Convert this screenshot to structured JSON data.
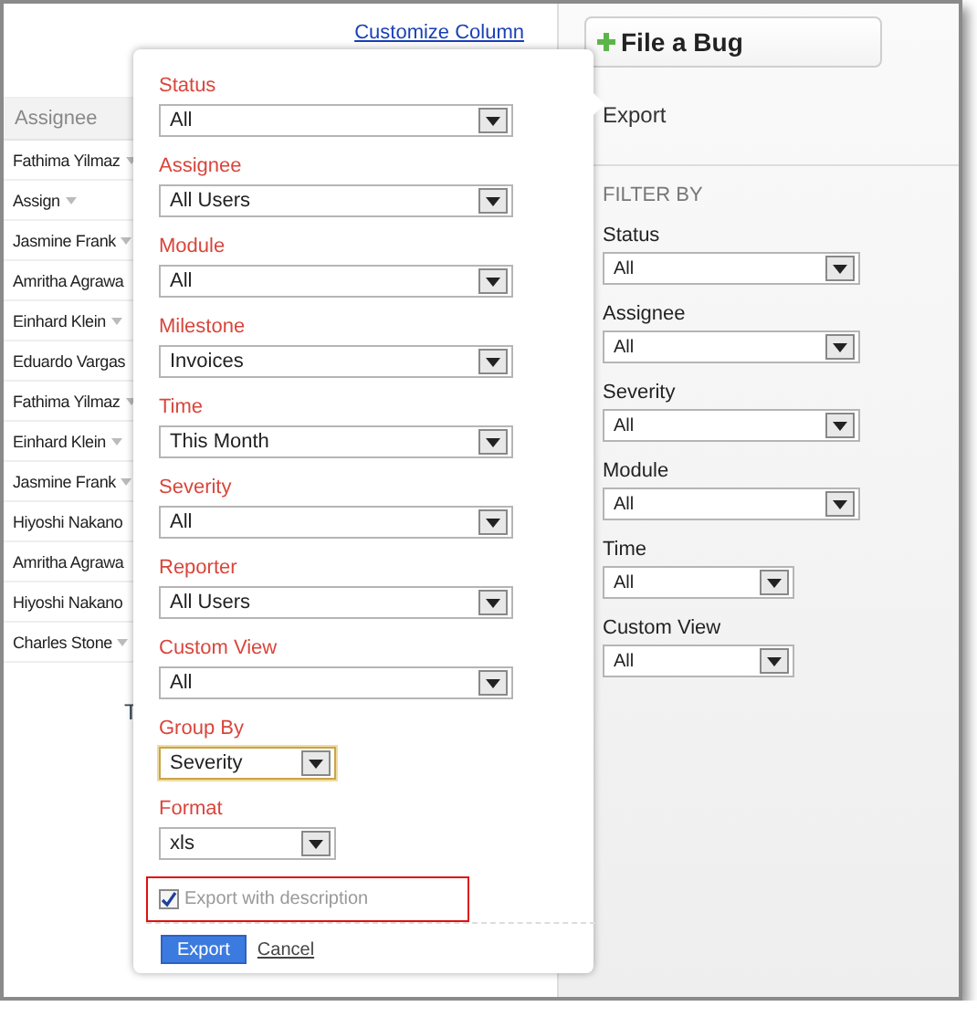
{
  "table": {
    "customize_link": "Customize Column",
    "header": "Assignee",
    "rows": [
      {
        "assignee": "Fathima Yilmaz",
        "caret": true
      },
      {
        "assignee": "Assign",
        "caret": true
      },
      {
        "assignee": "Jasmine Frank",
        "caret": true
      },
      {
        "assignee": "Amritha Agrawa",
        "caret": false
      },
      {
        "assignee": "Einhard Klein",
        "caret": true
      },
      {
        "assignee": "Eduardo Vargas",
        "caret": false
      },
      {
        "assignee": "Fathima Yilmaz",
        "caret": true
      },
      {
        "assignee": "Einhard Klein",
        "caret": true
      },
      {
        "assignee": "Jasmine Frank",
        "caret": true
      },
      {
        "assignee": "Hiyoshi Nakano",
        "caret": false
      },
      {
        "assignee": "Amritha Agrawa",
        "caret": false
      },
      {
        "assignee": "Hiyoshi Nakano",
        "caret": false
      },
      {
        "assignee": "Charles Stone",
        "caret": true
      }
    ],
    "footer_text": "T"
  },
  "sidebar": {
    "file_bug_button": "File a Bug",
    "export_link": "Export",
    "filter_heading": "FILTER BY",
    "filters": [
      {
        "label": "Status",
        "value": "All"
      },
      {
        "label": "Assignee",
        "value": "All"
      },
      {
        "label": "Severity",
        "value": "All"
      },
      {
        "label": "Module",
        "value": "All"
      },
      {
        "label": "Time",
        "value": "All"
      },
      {
        "label": "Custom View",
        "value": "All"
      }
    ]
  },
  "export_dialog": {
    "fields": [
      {
        "label": "Status",
        "value": "All",
        "focused": false
      },
      {
        "label": "Assignee",
        "value": "All Users",
        "focused": false
      },
      {
        "label": "Module",
        "value": "All",
        "focused": false
      },
      {
        "label": "Milestone",
        "value": "Invoices",
        "focused": false
      },
      {
        "label": "Time",
        "value": "This Month",
        "focused": false
      },
      {
        "label": "Severity",
        "value": "All",
        "focused": false
      },
      {
        "label": "Reporter",
        "value": "All Users",
        "focused": false
      },
      {
        "label": "Custom View",
        "value": "All",
        "focused": false
      },
      {
        "label": "Group By",
        "value": "Severity",
        "focused": true
      },
      {
        "label": "Format",
        "value": "xls",
        "focused": false
      }
    ],
    "checkbox": {
      "label": "Export with description",
      "checked": true
    },
    "export_button": "Export",
    "cancel_link": "Cancel"
  }
}
